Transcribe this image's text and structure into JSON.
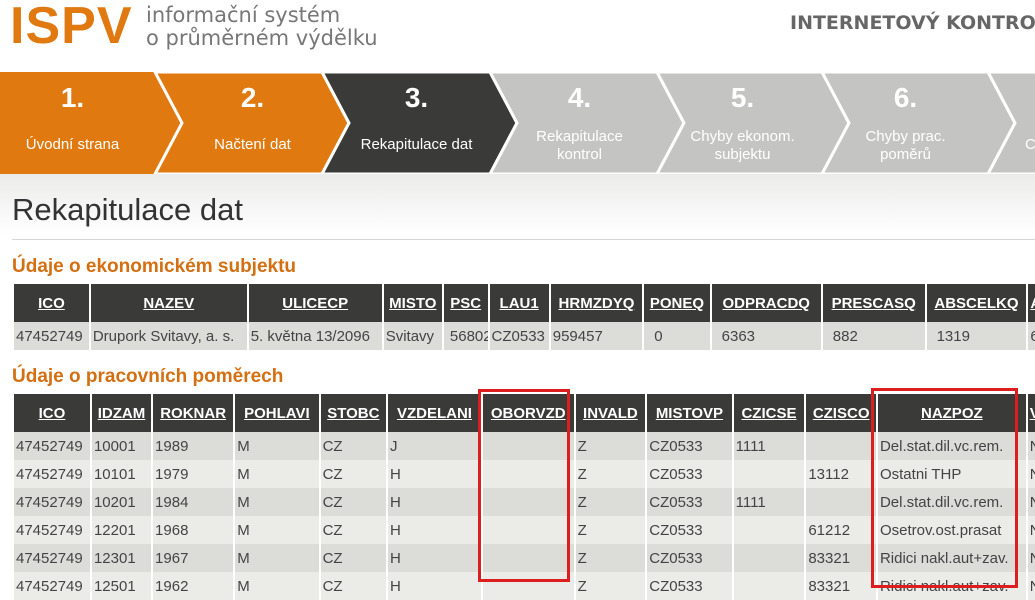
{
  "header": {
    "logo": "ISPV",
    "tagline_line1": "informační systém",
    "tagline_line2": "o průměrném výdělku",
    "title": "INTERNETOVÝ KONTRO"
  },
  "steps": [
    {
      "num": "1.",
      "label1": "Úvodní strana",
      "label2": "",
      "state": "done"
    },
    {
      "num": "2.",
      "label1": "Načtení dat",
      "label2": "",
      "state": "done"
    },
    {
      "num": "3.",
      "label1": "Rekapitulace dat",
      "label2": "",
      "state": "active"
    },
    {
      "num": "4.",
      "label1": "Rekapitulace",
      "label2": "kontrol",
      "state": "future"
    },
    {
      "num": "5.",
      "label1": "Chyby ekonom.",
      "label2": "subjektu",
      "state": "future"
    },
    {
      "num": "6.",
      "label1": "Chyby prac.",
      "label2": "poměrů",
      "state": "future"
    },
    {
      "num": "",
      "label1": "C",
      "label2": "",
      "state": "future"
    }
  ],
  "page": {
    "title": "Rekapitulace dat"
  },
  "subject": {
    "title": "Údaje o ekonomickém subjektu",
    "headers": [
      "ICO",
      "NAZEV",
      "ULICECP",
      "MISTO",
      "PSC",
      "LAU1",
      "HRMZDYQ",
      "PONEQ",
      "ODPRACDQ",
      "PRESCASQ",
      "ABSCELKQ",
      "A"
    ],
    "rows": [
      [
        "47452749",
        "Drupork Svitavy, a. s.",
        "5. května 13/2096",
        "Svitavy",
        "56802",
        "CZ0533",
        "959457",
        "0",
        "6363",
        "882",
        "1319",
        "60"
      ]
    ]
  },
  "employment": {
    "title": "Údaje o pracovních poměrech",
    "headers": [
      "ICO",
      "IDZAM",
      "ROKNAR",
      "POHLAVI",
      "STOBC",
      "VZDELANI",
      "OBORVZD",
      "INVALD",
      "MISTOVP",
      "CZICSE",
      "CZISCO",
      "NAZPOZ",
      "V"
    ],
    "rows": [
      [
        "47452749",
        "10001",
        "1989",
        "M",
        "CZ",
        "J",
        "",
        "Z",
        "CZ0533",
        "1111",
        "",
        "Del.stat.dil.vc.rem.",
        "N"
      ],
      [
        "47452749",
        "10101",
        "1979",
        "M",
        "CZ",
        "H",
        "",
        "Z",
        "CZ0533",
        "",
        "13112",
        "Ostatni THP",
        "N"
      ],
      [
        "47452749",
        "10201",
        "1984",
        "M",
        "CZ",
        "H",
        "",
        "Z",
        "CZ0533",
        "1111",
        "",
        "Del.stat.dil.vc.rem.",
        "N"
      ],
      [
        "47452749",
        "12201",
        "1968",
        "M",
        "CZ",
        "H",
        "",
        "Z",
        "CZ0533",
        "",
        "61212",
        "Osetrov.ost.prasat",
        "N"
      ],
      [
        "47452749",
        "12301",
        "1967",
        "M",
        "CZ",
        "H",
        "",
        "Z",
        "CZ0533",
        "",
        "83321",
        "Ridici nakl.aut+zav.",
        "N"
      ],
      [
        "47452749",
        "12501",
        "1962",
        "M",
        "CZ",
        "H",
        "",
        "Z",
        "CZ0533",
        "",
        "83321",
        "Ridici nakl.aut+zav.",
        "N"
      ]
    ]
  },
  "colors": {
    "accent_orange": "#e07a10",
    "active_step": "#3a3a38",
    "future_step": "#c4c4c2",
    "highlight_box": "#dc1e1e"
  }
}
